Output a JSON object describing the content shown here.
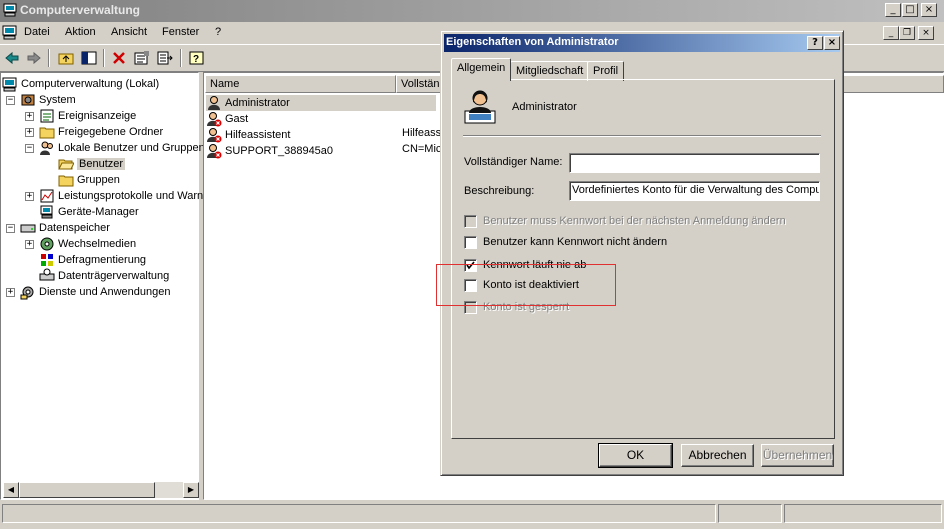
{
  "window": {
    "title": "Computerverwaltung",
    "controls": {
      "minimize": "_",
      "maximize": "□",
      "close": "×"
    }
  },
  "menu": {
    "items": [
      "Datei",
      "Aktion",
      "Ansicht",
      "Fenster",
      "?"
    ]
  },
  "toolbar": {
    "icons": [
      "back-arrow-icon",
      "forward-arrow-icon",
      "up-folder-icon",
      "show-hide-tree-icon",
      "delete-icon",
      "properties-icon",
      "export-list-icon",
      "help-icon"
    ]
  },
  "tree": {
    "root": "Computerverwaltung (Lokal)",
    "system": "System",
    "ereignisanzeige": "Ereignisanzeige",
    "freigegebene": "Freigegebene Ordner",
    "lokale": "Lokale Benutzer und Gruppen",
    "benutzer": "Benutzer",
    "gruppen": "Gruppen",
    "leistung": "Leistungsprotokolle und Warn",
    "geraete": "Geräte-Manager",
    "datenspeicher": "Datenspeicher",
    "wechselmedien": "Wechselmedien",
    "defrag": "Defragmentierung",
    "datentraeger": "Datenträgerverwaltung",
    "dienste": "Dienste und Anwendungen"
  },
  "list": {
    "columns": [
      "Name",
      "Vollständ"
    ],
    "rows": [
      {
        "name": "Administrator",
        "full": ""
      },
      {
        "name": "Gast",
        "full": ""
      },
      {
        "name": "Hilfeassistent",
        "full": "Hilfeassis"
      },
      {
        "name": "SUPPORT_388945a0",
        "full": "CN=Micr"
      }
    ]
  },
  "dialog": {
    "title": "Eigenschaften von Administrator",
    "help": "?",
    "close": "×",
    "tabs": [
      "Allgemein",
      "Mitgliedschaft",
      "Profil"
    ],
    "user_name": "Administrator",
    "fullname_label": "Vollständiger Name:",
    "fullname_value": "",
    "description_label": "Beschreibung:",
    "description_value": "Vordefiniertes Konto für die Verwaltung des Comput",
    "checkboxes": [
      {
        "label": "Benutzer muss Kennwort bei der nächsten Anmeldung ändern",
        "checked": false,
        "enabled": false
      },
      {
        "label": "Benutzer kann Kennwort nicht ändern",
        "checked": false,
        "enabled": true
      },
      {
        "label": "Kennwort läuft nie ab",
        "checked": true,
        "enabled": true
      },
      {
        "label": "Konto ist deaktiviert",
        "checked": false,
        "enabled": true
      },
      {
        "label": "Konto ist gesperrt",
        "checked": false,
        "enabled": false
      }
    ],
    "buttons": {
      "ok": "OK",
      "cancel": "Abbrechen",
      "apply": "Übernehmen"
    }
  },
  "colors": {
    "dialog_title_active": "#0a246a",
    "window_title_inactive": "#808080",
    "highlight_box": "#e03030"
  }
}
